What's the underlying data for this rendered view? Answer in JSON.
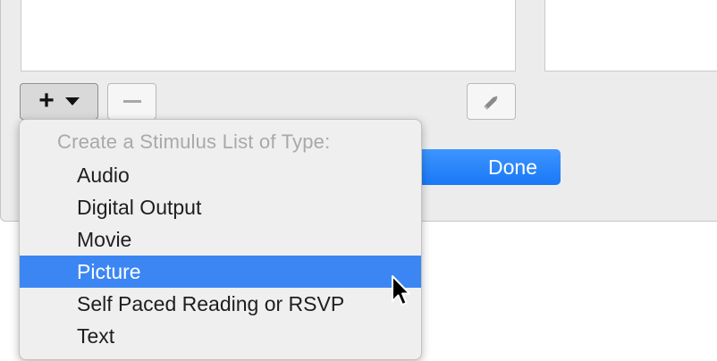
{
  "toolbar": {
    "add_button": {
      "symbol": "+",
      "icon": "plus-icon",
      "dropdown_icon": "chevron-down-icon"
    },
    "remove_button": {
      "icon": "minus-icon"
    },
    "edit_button": {
      "icon": "pencil-icon"
    }
  },
  "done_button": {
    "label": "Done"
  },
  "menu": {
    "header": "Create a Stimulus List of Type:",
    "items": [
      {
        "label": "Audio",
        "selected": false
      },
      {
        "label": "Digital Output",
        "selected": false
      },
      {
        "label": "Movie",
        "selected": false
      },
      {
        "label": "Picture",
        "selected": true
      },
      {
        "label": "Self Paced Reading or RSVP",
        "selected": false
      },
      {
        "label": "Text",
        "selected": false
      }
    ]
  },
  "colors": {
    "accent": "#3c86f3",
    "done_button": "#1a78f6"
  }
}
